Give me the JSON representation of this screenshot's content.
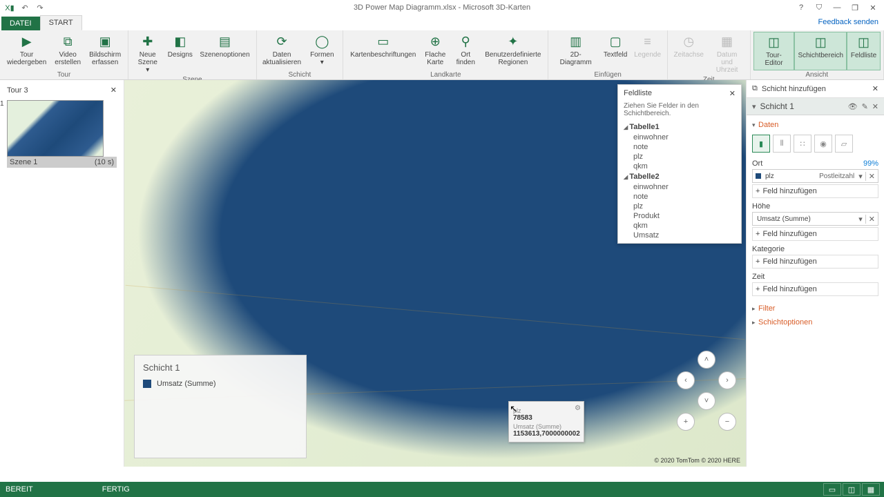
{
  "title": "3D Power Map Diagramm.xlsx - Microsoft 3D-Karten",
  "qat": {
    "excel": "X▮",
    "undo": "↶",
    "redo": "↷"
  },
  "win": {
    "help": "?",
    "opts": "⛉",
    "min": "—",
    "max": "❐",
    "close": "✕"
  },
  "tabs": {
    "file": "DATEI",
    "start": "START"
  },
  "feedback": "Feedback senden",
  "ribbon": {
    "g1": {
      "label": "Tour",
      "b1": "Tour\nwiedergeben",
      "b2": "Video\nerstellen",
      "b3": "Bildschirm\nerfassen"
    },
    "g2": {
      "label": "Szene",
      "b1": "Neue\nSzene ▾",
      "b2": "Designs",
      "b3": "Szenenoptionen"
    },
    "g3": {
      "label": "Schicht",
      "b1": "Daten\naktualisieren",
      "b2": "Formen ▾"
    },
    "g4": {
      "label": "Landkarte",
      "b1": "Kartenbeschriftungen",
      "b2": "Flache\nKarte",
      "b3": "Ort\nfinden",
      "b4": "Benutzerdefinierte\nRegionen"
    },
    "g5": {
      "label": "Einfügen",
      "b1": "2D-Diagramm",
      "b2": "Textfeld",
      "b3": "Legende"
    },
    "g6": {
      "label": "Zeit",
      "b1": "Zeitachse",
      "b2": "Datum und\nUhrzeit"
    },
    "g7": {
      "label": "Ansicht",
      "b1": "Tour-Editor",
      "b2": "Schichtbereich",
      "b3": "Feldliste"
    }
  },
  "tour": {
    "name": "Tour 3",
    "scene_num": "1",
    "scene_name": "Szene 1",
    "scene_dur": "(10 s)"
  },
  "fieldlist": {
    "title": "Feldliste",
    "hint": "Ziehen Sie Felder in den Schichtbereich.",
    "t1": {
      "name": "Tabelle1",
      "f": [
        "einwohner",
        "note",
        "plz",
        "qkm"
      ]
    },
    "t2": {
      "name": "Tabelle2",
      "f": [
        "einwohner",
        "note",
        "plz",
        "Produkt",
        "qkm",
        "Umsatz"
      ]
    }
  },
  "legend": {
    "title": "Schicht 1",
    "item": "Umsatz (Summe)"
  },
  "tooltip": {
    "k1": "plz",
    "v1": "78583",
    "k2": "Umsatz (Summe)",
    "v2": "1153613,7000000002"
  },
  "attrib": "© 2020 TomTom © 2020 HERE",
  "layerpane": {
    "add": "Schicht hinzufügen",
    "layer": "Schicht 1",
    "sec_data": "Daten",
    "ort": "Ort",
    "pct": "99%",
    "plz_field": "plz",
    "plz_type": "Postleitzahl",
    "addfield": "Feld hinzufügen",
    "hohe": "Höhe",
    "hohe_field": "Umsatz (Summe)",
    "kat": "Kategorie",
    "zeit": "Zeit",
    "filter": "Filter",
    "opts": "Schichtoptionen"
  },
  "status": {
    "s1": "BEREIT",
    "s2": "FERTIG"
  }
}
